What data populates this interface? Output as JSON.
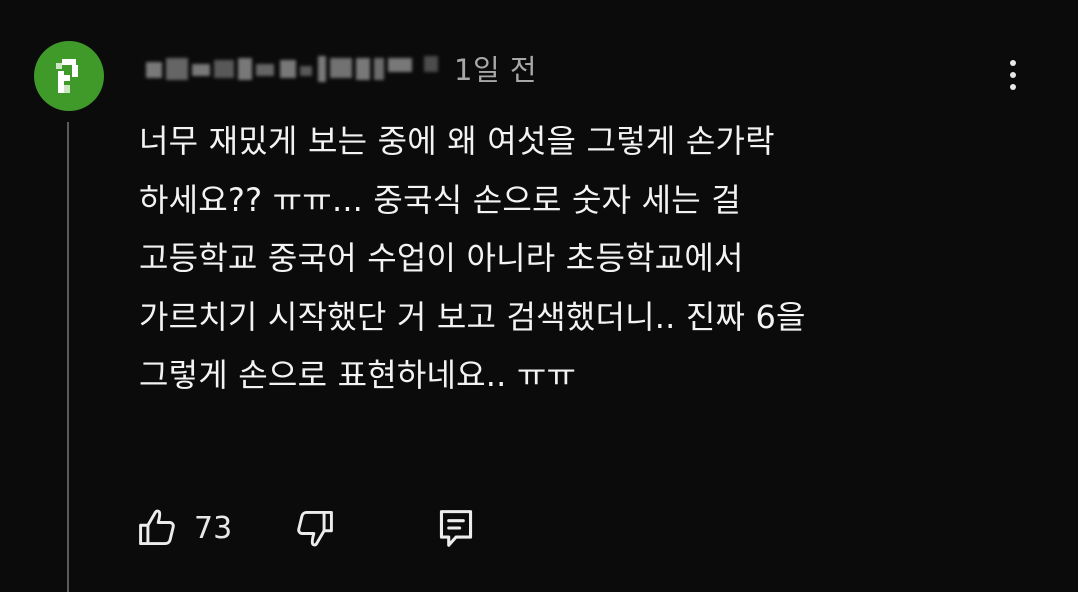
{
  "comment": {
    "author_name_redacted": true,
    "time": "1일 전",
    "text_lines": [
      "너무 재밌게 보는 중에 왜 여섯을 그렇게 손가락",
      "하세요?? ㅠㅠ... 중국식 손으로 숫자 세는 걸",
      "고등학교 중국어 수업이 아니라 초등학교에서",
      "가르치기 시작했단 거 보고 검색했더니.. 진짜 6을",
      "그렇게 손으로 표현하네요.. ㅠㅠ"
    ],
    "like_count": "73"
  },
  "icons": {
    "more": "more-vertical-icon",
    "like": "thumbs-up-icon",
    "dislike": "thumbs-down-icon",
    "reply": "comment-reply-icon"
  },
  "colors": {
    "background": "#0b0b0b",
    "avatar": "#3f9a2a",
    "text": "#f3f3f3",
    "secondary_text": "#a8a8a8",
    "thread_line": "#5a5a5a"
  }
}
